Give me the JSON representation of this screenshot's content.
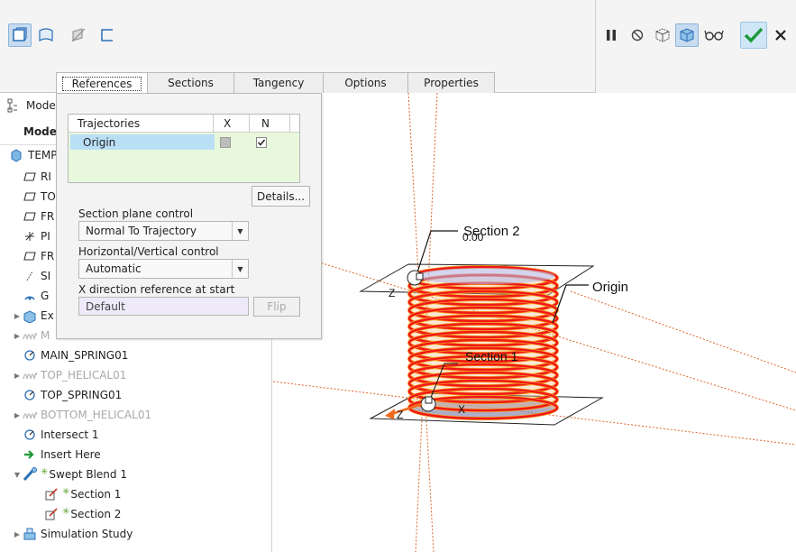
{
  "ribbon": {
    "tools": [
      {
        "icon": "solid-icon",
        "active": true
      },
      {
        "icon": "surface-icon",
        "active": false
      },
      {
        "icon": "remove-material-icon",
        "active": false
      },
      {
        "icon": "thicken-icon",
        "active": false
      }
    ],
    "right_tools": [
      "pause-icon",
      "no-preview-icon",
      "verify-preview-icon",
      "feature-preview-icon",
      "glasses-icon",
      "ok-check-icon",
      "cancel-x-icon"
    ]
  },
  "tabs": [
    {
      "label": "References",
      "active": true
    },
    {
      "label": "Sections",
      "active": false
    },
    {
      "label": "Tangency",
      "active": false
    },
    {
      "label": "Options",
      "active": false
    },
    {
      "label": "Properties",
      "active": false
    }
  ],
  "sidebar": {
    "header_label": "Mode",
    "subheader_label": "Mode",
    "root_label": "TEMP",
    "items": [
      {
        "label": "RI",
        "icon": "datum-plane-icon",
        "indent": 1
      },
      {
        "label": "TO",
        "icon": "datum-plane-icon",
        "indent": 1
      },
      {
        "label": "FR",
        "icon": "datum-plane-icon",
        "indent": 1
      },
      {
        "label": "PI",
        "icon": "csys-icon",
        "indent": 1
      },
      {
        "label": "FR",
        "icon": "datum-plane-icon",
        "indent": 1
      },
      {
        "label": "SI",
        "icon": "datum-axis-icon",
        "indent": 1
      },
      {
        "label": "G",
        "icon": "gear-icon",
        "indent": 1
      },
      {
        "label": "Ex",
        "icon": "extrude-icon",
        "indent": 1,
        "expandable": true
      },
      {
        "label": "M",
        "icon": "helical-sweep-icon",
        "indent": 1,
        "expandable": true,
        "dim": true
      },
      {
        "label": "MAIN_SPRING01",
        "icon": "sketch-icon",
        "indent": 1
      },
      {
        "label": "TOP_HELICAL01",
        "icon": "helical-sweep-icon",
        "indent": 1,
        "expandable": true,
        "dim": true
      },
      {
        "label": "TOP_SPRING01",
        "icon": "sketch-icon",
        "indent": 1
      },
      {
        "label": "BOTTOM_HELICAL01",
        "icon": "helical-sweep-icon",
        "indent": 1,
        "expandable": true,
        "dim": true
      },
      {
        "label": "Intersect 1",
        "icon": "sketch-icon",
        "indent": 1
      },
      {
        "label": "Insert Here",
        "icon": "insert-arrow-icon",
        "indent": 1
      },
      {
        "label": "Swept Blend 1",
        "icon": "swept-blend-icon",
        "indent": 1,
        "expanded": true,
        "star": true
      },
      {
        "label": "Section 1",
        "icon": "section-sketch-icon",
        "indent": 2,
        "star": true
      },
      {
        "label": "Section 2",
        "icon": "section-sketch-icon",
        "indent": 2,
        "star": true
      },
      {
        "label": "Simulation Study",
        "icon": "simulation-icon",
        "indent": 1,
        "expandable": true
      }
    ]
  },
  "panel": {
    "table": {
      "headers": [
        "Trajectories",
        "X",
        "N"
      ],
      "rows": [
        {
          "name": "Origin",
          "x": "grey",
          "n": "checked"
        }
      ]
    },
    "details_label": "Details...",
    "section_plane_label": "Section plane control",
    "section_plane_value": "Normal To Trajectory",
    "hv_control_label": "Horizontal/Vertical control",
    "hv_control_value": "Automatic",
    "xdir_label": "X direction reference at start",
    "xdir_value": "Default",
    "flip_label": "Flip"
  },
  "viewport": {
    "labels": {
      "section2": "Section 2",
      "section2_value": "0.00",
      "section1": "Section 1",
      "origin": "Origin",
      "z_top": "Z",
      "z_bottom": "Z",
      "x_bottom": "X"
    },
    "colors": {
      "coil": "#f01818",
      "coil_edge": "#f5a623",
      "datum": "#e0642a",
      "body_shadow": "#8a8ab0"
    }
  }
}
